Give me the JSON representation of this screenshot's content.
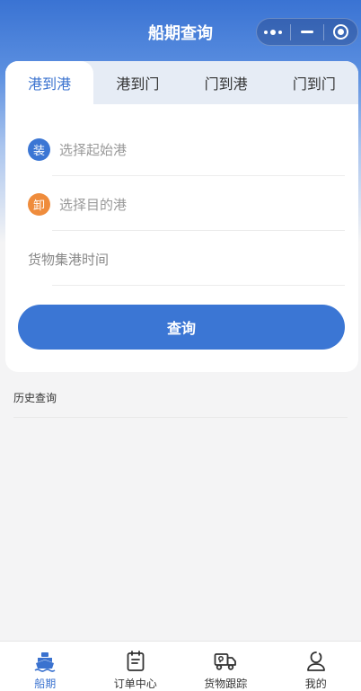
{
  "navbar": {
    "title": "船期查询",
    "capsule": {
      "more_icon": "more-dots-icon",
      "minimize_icon": "minimize-icon",
      "close_icon": "target-circle-icon"
    }
  },
  "route_tabs": [
    {
      "label": "港到港",
      "active": true
    },
    {
      "label": "港到门",
      "active": false
    },
    {
      "label": "门到港",
      "active": false
    },
    {
      "label": "门到门",
      "active": false
    }
  ],
  "form": {
    "origin": {
      "badge": "装",
      "badge_color": "#3b76d4",
      "placeholder": "选择起始港"
    },
    "destination": {
      "badge": "卸",
      "badge_color": "#ef8c3c",
      "placeholder": "选择目的港"
    },
    "date": {
      "placeholder": "货物集港时间"
    },
    "submit_label": "查询"
  },
  "history": {
    "title": "历史查询"
  },
  "tabbar": {
    "items": [
      {
        "label": "船期",
        "icon": "ship-icon",
        "active": true
      },
      {
        "label": "订单中心",
        "icon": "clipboard-icon",
        "active": false
      },
      {
        "label": "货物跟踪",
        "icon": "truck-icon",
        "active": false
      },
      {
        "label": "我的",
        "icon": "user-icon",
        "active": false
      }
    ]
  },
  "colors": {
    "primary": "#3b76d4",
    "accent_orange": "#ef8c3c",
    "background": "#f4f4f5"
  }
}
